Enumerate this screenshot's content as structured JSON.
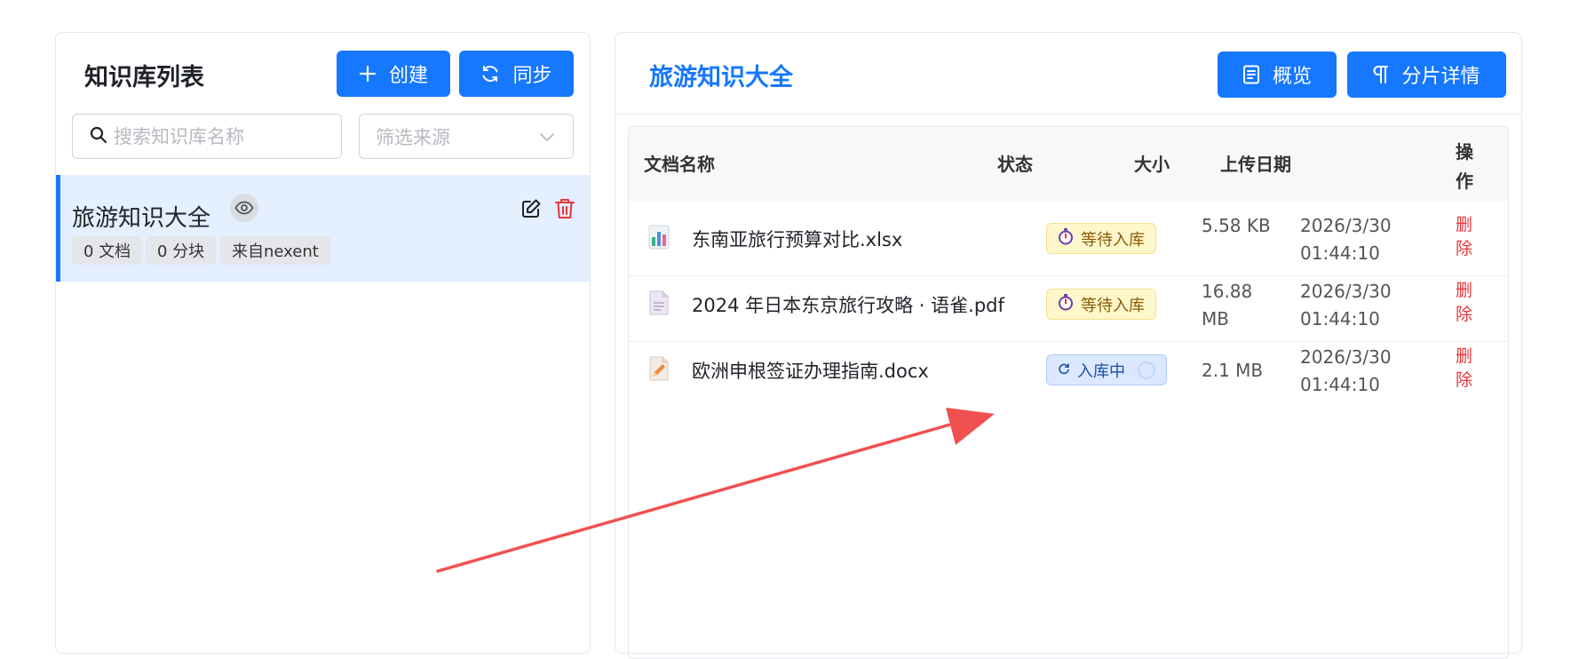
{
  "left": {
    "title": "知识库列表",
    "create_label": "创建",
    "sync_label": "同步",
    "search_placeholder": "搜索知识库名称",
    "filter_placeholder": "筛选来源",
    "kb_items": [
      {
        "name": "旅游知识大全",
        "tags": [
          "0 文档",
          "0 分块",
          "来自nexent"
        ]
      }
    ]
  },
  "right": {
    "title": "旅游知识大全",
    "overview_label": "概览",
    "chunks_label": "分片详情",
    "columns": [
      "文档名称",
      "状态",
      "大小",
      "上传日期",
      "操作"
    ],
    "rows": [
      {
        "name": "东南亚旅行预算对比.xlsx",
        "icon": "spreadsheet-icon",
        "status": "等待入库",
        "status_icon": "stopwatch-icon",
        "size": "5.58 KB",
        "date": "2026/3/30 01:44:10",
        "action": "删除"
      },
      {
        "name": "2024 年日本东京旅行攻略 · 语雀.pdf",
        "icon": "pdf-document-icon",
        "status": "等待入库",
        "status_icon": "stopwatch-icon",
        "size": "16.88 MB",
        "date": "2026/3/30 01:44:10",
        "action": "删除"
      },
      {
        "name": "欧洲申根签证办理指南.docx",
        "icon": "word-document-icon",
        "status": "入库中",
        "status_icon": "refresh-icon",
        "size": "2.1 MB",
        "date": "2026/3/30 01:44:10",
        "action": "删除"
      }
    ]
  },
  "colors": {
    "primary": "#1677ff",
    "danger": "#e5353b",
    "annotation_arrow": "#f0504f"
  }
}
